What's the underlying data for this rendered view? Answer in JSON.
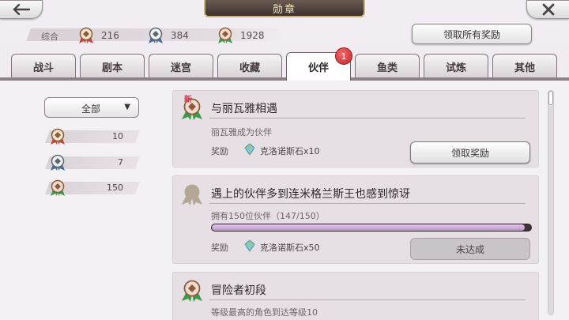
{
  "header": {
    "title": "勋章",
    "back_icon": "left-arrow-icon",
    "close_icon": "close-x-icon"
  },
  "summary": {
    "label": "综合",
    "gold": "216",
    "silver": "384",
    "bronze": "1928",
    "claim_all_label": "领取所有奖励"
  },
  "tabs": [
    {
      "label": "战斗"
    },
    {
      "label": "剧本"
    },
    {
      "label": "迷宫"
    },
    {
      "label": "收藏"
    },
    {
      "label": "伙伴",
      "active": true
    },
    {
      "label": "鱼类"
    },
    {
      "label": "试炼"
    },
    {
      "label": "其他"
    }
  ],
  "tab_badge": "1",
  "filter": {
    "selected": "全部",
    "counts": {
      "gold": "10",
      "silver": "7",
      "bronze": "150"
    }
  },
  "achievements": [
    {
      "badge_new": "新",
      "title": "与丽瓦雅相遇",
      "desc": "丽瓦雅成为伙伴",
      "reward_label": "奖励",
      "reward_text": "克洛诺斯石x10",
      "button": "领取奖励",
      "state": "claimable"
    },
    {
      "title": "遇上的伙伴多到连米格兰斯王也感到惊讶",
      "desc": "拥有150位伙伴（147/150）",
      "progress": 0.98,
      "reward_label": "奖励",
      "reward_text": "克洛诺斯石x50",
      "button": "未达成",
      "state": "locked"
    },
    {
      "title": "冒险者初段",
      "desc": "等级最高的角色到达等级10",
      "state": "partial"
    }
  ],
  "colors": {
    "gold": "#c9453a",
    "silver": "#4a6d9a",
    "bronze": "#8e5a3c",
    "ribbon_green": "#3f9a4a"
  }
}
